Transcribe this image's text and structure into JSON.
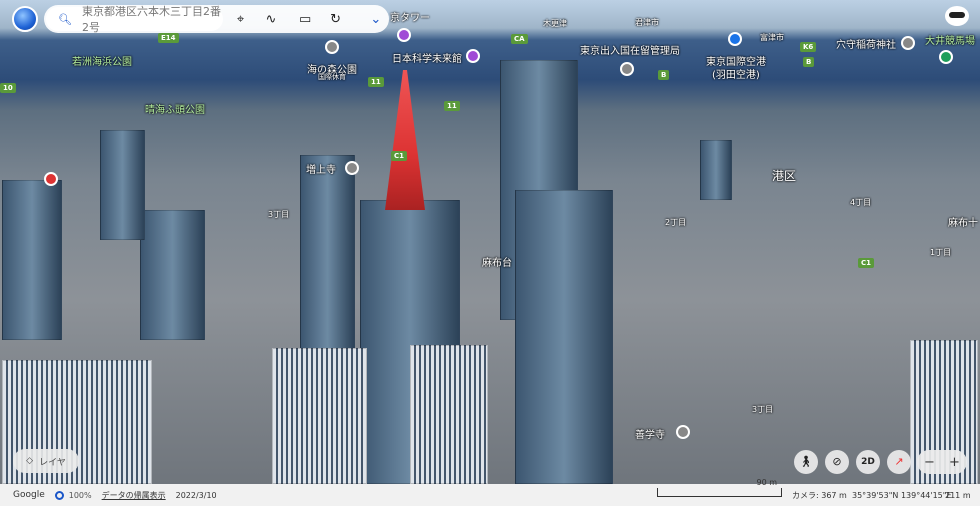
{
  "search": {
    "placeholder": "東京都港区六本木三丁目2番2号"
  },
  "toolbar": {
    "search_icon": "search-icon",
    "place_icon": "pin-icon",
    "path_icon": "path-icon",
    "measure_icon": "ruler-icon",
    "history_icon": "history-icon",
    "expand_icon": "chevron-down-icon"
  },
  "map_labels": {
    "tokyo_tower": "京タワー",
    "miraikan": "日本科学未来館",
    "kisarazu": "木更津",
    "kimitsu": "君津市",
    "immigration": "東京出入国在留管理局",
    "futtsu": "富津市",
    "haneda": "東京国際空港",
    "haneda_sub": "(羽田空港)",
    "anamori": "穴守稲荷神社",
    "oi": "大井競馬場",
    "wakasu": "若洲海浜公園",
    "uminomori": "海の森公園",
    "uminomori_sub": "国際休育",
    "harumi": "晴海ふ頭公園",
    "zojoji": "増上寺",
    "sanchome1": "3丁目",
    "azabudai": "麻布台",
    "minato": "港区",
    "nichome": "2丁目",
    "yonchome": "4丁目",
    "icchome": "1丁目",
    "azabuju": "麻布十",
    "zengakuji": "善学寺",
    "sanchome2": "3丁目"
  },
  "shields": {
    "e14": "E14",
    "ca": "CA",
    "k6": "K6",
    "b1": "B",
    "b2": "B",
    "r11a": "11",
    "r11b": "11",
    "c1a": "C1",
    "c1b": "C1",
    "r10": "10"
  },
  "controls": {
    "layers": "レイヤ",
    "twod": "2D",
    "zoom_out": "−",
    "zoom_in": "+"
  },
  "footer": {
    "brand": "Google",
    "percent": "100%",
    "data_link": "データの帰属表示",
    "date": "2022/3/10",
    "scale": "90 m",
    "camera": "カメラ: 367 m",
    "coords": "35°39'53\"N 139°44'15\"E",
    "elevation": "211 m"
  }
}
